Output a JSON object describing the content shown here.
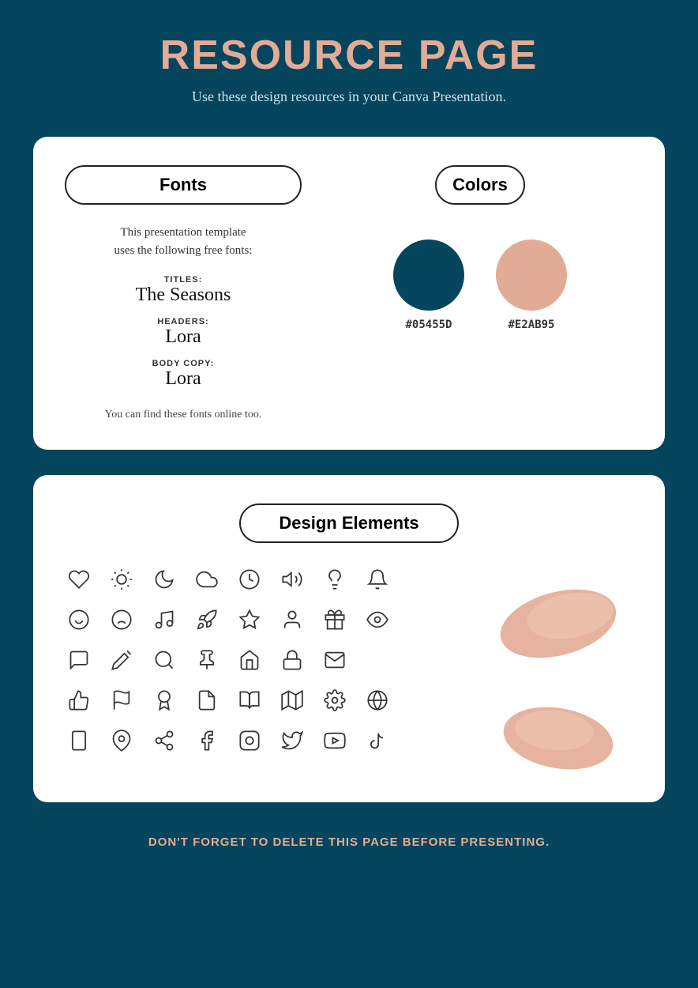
{
  "header": {
    "title": "RESOURCE PAGE",
    "subtitle": "Use these design resources in your Canva Presentation."
  },
  "fonts_section": {
    "label": "Fonts",
    "intro_line1": "This presentation template",
    "intro_line2": "uses the following free fonts:",
    "titles_label": "TITLES:",
    "titles_font": "The Seasons",
    "headers_label": "HEADERS:",
    "headers_font": "Lora",
    "body_label": "BODY COPY:",
    "body_font": "Lora",
    "footer": "You can find these fonts online too."
  },
  "colors_section": {
    "label": "Colors",
    "swatches": [
      {
        "hex": "#05455D",
        "label": "#05455D"
      },
      {
        "hex": "#E2AB95",
        "label": "#E2AB95"
      }
    ]
  },
  "design_elements": {
    "label": "Design Elements"
  },
  "footer": {
    "text": "DON'T FORGET TO DELETE THIS PAGE BEFORE PRESENTING."
  }
}
